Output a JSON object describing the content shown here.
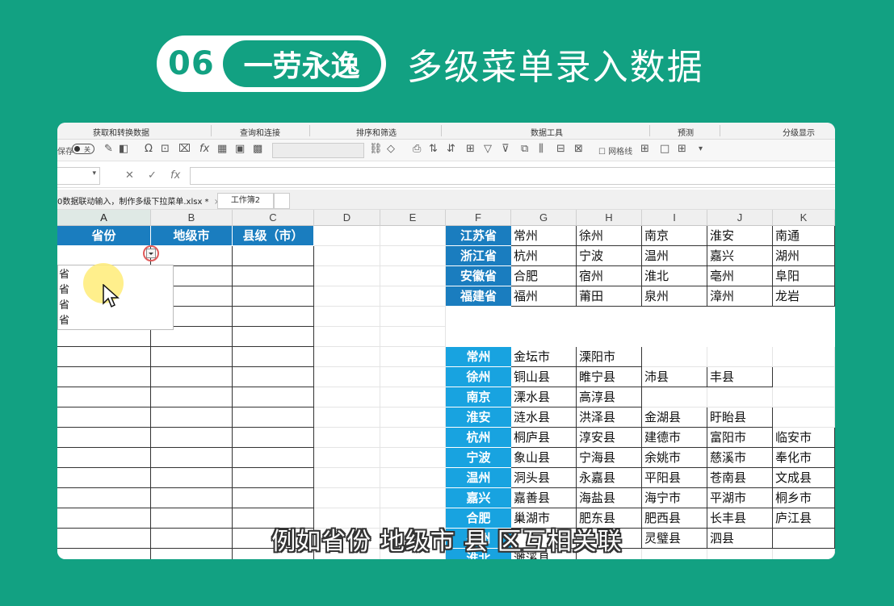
{
  "banner": {
    "number": "06",
    "tag": "一劳永逸",
    "title": "多级菜单录入数据"
  },
  "ribbon": {
    "tabs": [
      "获取和转换数据",
      "查询和连接",
      "排序和筛选",
      "数据工具",
      "预测",
      "分级显示"
    ],
    "left_label": "保存",
    "toggle_label": "关",
    "gridlines_label": "网格线"
  },
  "formula": {
    "fx": "fx",
    "cancel": "✕",
    "confirm": "✓"
  },
  "files": {
    "active": "0数据联动输入，制作多级下拉菜单.xlsx *",
    "close": "×",
    "sheet2": "工作簿2"
  },
  "columns": [
    "A",
    "B",
    "C",
    "D",
    "E",
    "F",
    "G",
    "H",
    "I",
    "J",
    "K"
  ],
  "entry_table": {
    "headers": [
      "省份",
      "地级市",
      "县级（市）"
    ]
  },
  "dropdown": {
    "items": [
      "省",
      "省",
      "省",
      "省"
    ]
  },
  "province_table": [
    {
      "name": "江苏省",
      "cities": [
        "常州",
        "徐州",
        "南京",
        "淮安",
        "南通"
      ]
    },
    {
      "name": "浙江省",
      "cities": [
        "杭州",
        "宁波",
        "温州",
        "嘉兴",
        "湖州"
      ]
    },
    {
      "name": "安徽省",
      "cities": [
        "合肥",
        "宿州",
        "淮北",
        "亳州",
        "阜阳"
      ]
    },
    {
      "name": "福建省",
      "cities": [
        "福州",
        "莆田",
        "泉州",
        "漳州",
        "龙岩"
      ]
    }
  ],
  "city_table": [
    {
      "name": "常州",
      "counties": [
        "金坛市",
        "溧阳市"
      ]
    },
    {
      "name": "徐州",
      "counties": [
        "铜山县",
        "睢宁县",
        "沛县",
        "丰县"
      ]
    },
    {
      "name": "南京",
      "counties": [
        "溧水县",
        "高淳县"
      ]
    },
    {
      "name": "淮安",
      "counties": [
        "涟水县",
        "洪泽县",
        "金湖县",
        "盱眙县"
      ]
    },
    {
      "name": "杭州",
      "counties": [
        "桐庐县",
        "淳安县",
        "建德市",
        "富阳市",
        "临安市"
      ]
    },
    {
      "name": "宁波",
      "counties": [
        "象山县",
        "宁海县",
        "余姚市",
        "慈溪市",
        "奉化市"
      ]
    },
    {
      "name": "温州",
      "counties": [
        "洞头县",
        "永嘉县",
        "平阳县",
        "苍南县",
        "文成县"
      ]
    },
    {
      "name": "嘉兴",
      "counties": [
        "嘉善县",
        "海盐县",
        "海宁市",
        "平湖市",
        "桐乡市"
      ]
    },
    {
      "name": "合肥",
      "counties": [
        "巢湖市",
        "肥东县",
        "肥西县",
        "长丰县",
        "庐江县"
      ]
    },
    {
      "name": "宿州",
      "counties": [
        "",
        "",
        "灵璧县",
        "泗县",
        ""
      ]
    },
    {
      "name": "淮北",
      "counties": [
        "濉溪县"
      ]
    }
  ],
  "subtitle": "例如省份 地级市 县 区互相关联",
  "colors": {
    "teal": "#12a182",
    "header_blue": "#1a7dbf",
    "light_blue": "#18a3e0"
  }
}
